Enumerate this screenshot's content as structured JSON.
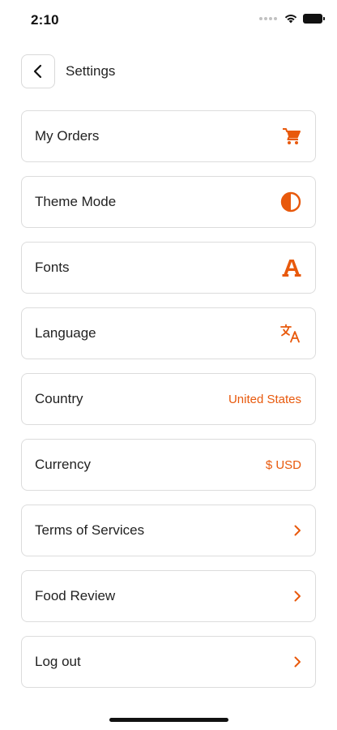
{
  "status_bar": {
    "time": "2:10"
  },
  "header": {
    "title": "Settings"
  },
  "accent_color": "#E8590C",
  "items": [
    {
      "label": "My Orders",
      "trailing": "cart-icon"
    },
    {
      "label": "Theme Mode",
      "trailing": "contrast-icon"
    },
    {
      "label": "Fonts",
      "trailing": "font-icon"
    },
    {
      "label": "Language",
      "trailing": "translate-icon"
    },
    {
      "label": "Country",
      "value": "United States"
    },
    {
      "label": "Currency",
      "value": "$ USD"
    },
    {
      "label": "Terms of Services",
      "trailing": "chevron-right-icon"
    },
    {
      "label": "Food Review",
      "trailing": "chevron-right-icon"
    },
    {
      "label": "Log out",
      "trailing": "chevron-right-icon"
    }
  ]
}
